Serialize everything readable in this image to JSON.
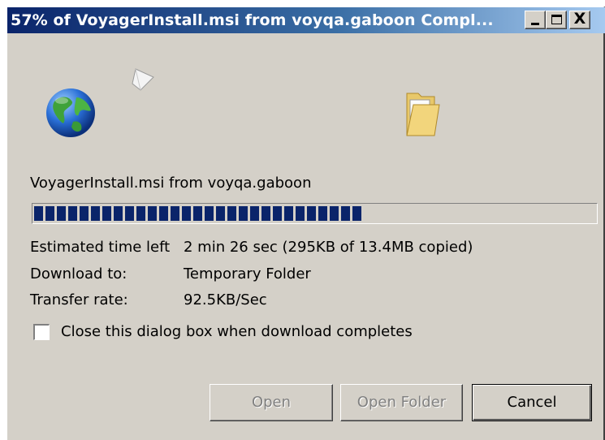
{
  "window": {
    "title": "57% of VoyagerInstall.msi from voyqa.gaboon Compl...",
    "controls": {
      "minimize": "_",
      "maximize": "□",
      "close": "X"
    }
  },
  "icons": {
    "source": "globe-icon",
    "transfer": "paper-icon",
    "destination": "folder-icon"
  },
  "download": {
    "file_label": "VoyagerInstall.msi from voyqa.gaboon",
    "progress_percent": 57,
    "estimated_label": "Estimated time left",
    "estimated_value": "2 min 26 sec (295KB of 13.4MB copied)",
    "download_to_label": "Download to:",
    "download_to_value": "Temporary Folder",
    "rate_label": "Transfer rate:",
    "rate_value": "92.5KB/Sec"
  },
  "options": {
    "close_on_complete_label": "Close this dialog box when download completes",
    "close_on_complete_checked": false
  },
  "buttons": {
    "open": "Open",
    "open_folder": "Open Folder",
    "cancel": "Cancel"
  },
  "colors": {
    "titlebar_start": "#0a246a",
    "titlebar_end": "#a6caf0",
    "progress": "#0a246a",
    "face": "#d4d0c8"
  }
}
